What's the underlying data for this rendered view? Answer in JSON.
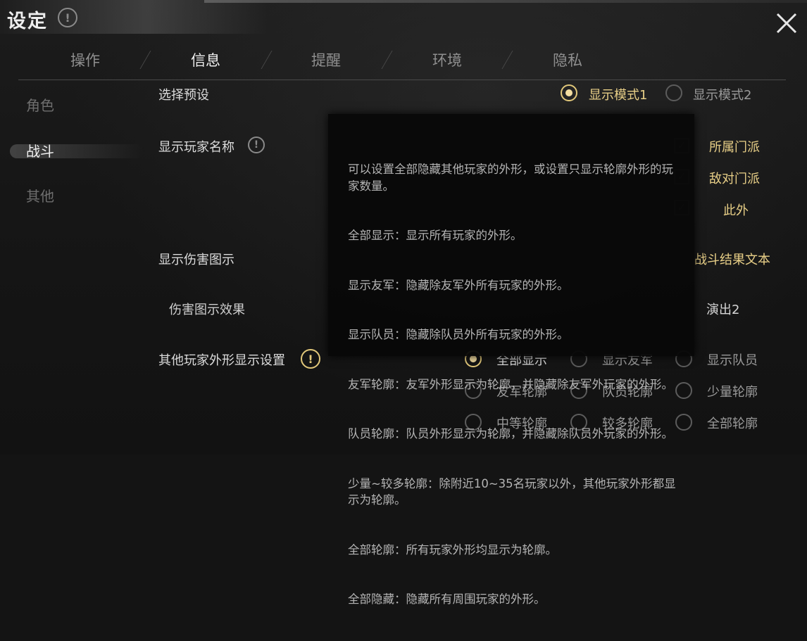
{
  "window": {
    "title": "设定",
    "info_icon": "info-icon",
    "close_icon": "close-icon"
  },
  "tabs": [
    {
      "label": "操作",
      "active": false
    },
    {
      "label": "信息",
      "active": true
    },
    {
      "label": "提醒",
      "active": false
    },
    {
      "label": "环境",
      "active": false
    },
    {
      "label": "隐私",
      "active": false
    }
  ],
  "sidebar": {
    "items": [
      {
        "label": "角色",
        "active": false
      },
      {
        "label": "战斗",
        "active": true
      },
      {
        "label": "其他",
        "active": false
      }
    ]
  },
  "settings": {
    "preset": {
      "label": "选择预设",
      "options": [
        {
          "label": "显示模式1",
          "selected": true
        },
        {
          "label": "显示模式2",
          "selected": false
        }
      ]
    },
    "player_name": {
      "label": "显示玩家名称",
      "options_right": [
        "所属门派",
        "敌对门派",
        "此外"
      ]
    },
    "damage": {
      "label": "显示伤害图示",
      "right_label": "战斗结果文本"
    },
    "damage_effect": {
      "label": "伤害图示效果",
      "right_label": "演出2"
    },
    "appearance": {
      "label": "其他玩家外形显示设置",
      "options": [
        {
          "label": "全部显示",
          "selected": true
        },
        {
          "label": "显示友军",
          "selected": false
        },
        {
          "label": "显示队员",
          "selected": false
        },
        {
          "label": "友军轮廓",
          "selected": false
        },
        {
          "label": "队员轮廓",
          "selected": false
        },
        {
          "label": "少量轮廓",
          "selected": false
        },
        {
          "label": "中等轮廓",
          "selected": false
        },
        {
          "label": "较多轮廓",
          "selected": false
        },
        {
          "label": "全部轮廓",
          "selected": false
        }
      ]
    }
  },
  "tooltip": {
    "lines": [
      "可以设置全部隐藏其他玩家的外形，或设置只显示轮廓外形的玩家数量。",
      "全部显示：显示所有玩家的外形。",
      "显示友军：隐藏除友军外所有玩家的外形。",
      "显示队员：隐藏除队员外所有玩家的外形。",
      "友军轮廓：友军外形显示为轮廓，并隐藏除友军外玩家的外形。",
      "队员轮廓：队员外形显示为轮廓，并隐藏除队员外玩家的外形。",
      "少量~较多轮廓：除附近10~35名玩家以外，其他玩家外形都显示为轮廓。",
      "全部轮廓：所有玩家外形均显示为轮廓。",
      "全部隐藏：隐藏所有周围玩家的外形。"
    ]
  },
  "colors": {
    "accent": "#e8cf87",
    "background": "#141414",
    "tooltip_bg": "#080808"
  }
}
